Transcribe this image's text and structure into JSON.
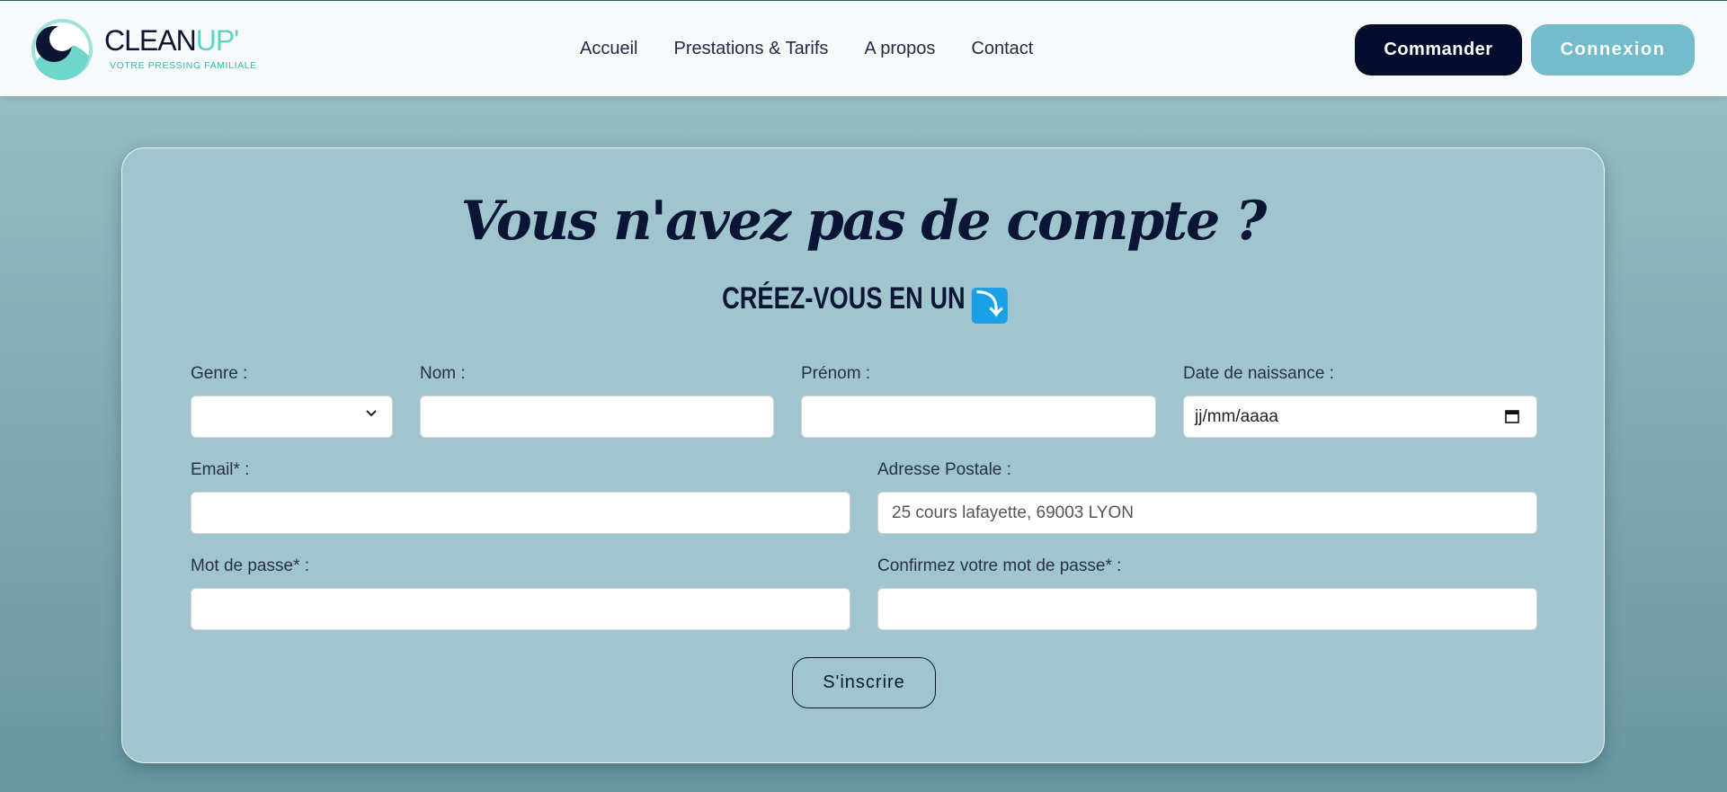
{
  "header": {
    "logo_text_main": "CLEAN",
    "logo_text_accent": "UP'",
    "logo_tagline": "VOTRE PRESSING FAMILIALE",
    "nav": [
      "Accueil",
      "Prestations & Tarifs",
      "A propos",
      "Contact"
    ],
    "commander_label": "Commander",
    "connexion_label": "Connexion"
  },
  "form": {
    "title": "Vous n'avez pas de compte ?",
    "subtitle": "CRÉEZ-VOUS EN UN",
    "subtitle_icon": "arrow-down-right-icon",
    "labels": {
      "genre": "Genre :",
      "nom": "Nom :",
      "prenom": "Prénom :",
      "date_naissance": "Date de naissance :",
      "email": "Email* :",
      "adresse": "Adresse Postale :",
      "password": "Mot de passe* :",
      "password_confirm": "Confirmez votre mot de passe* :"
    },
    "values": {
      "genre": "",
      "nom": "",
      "prenom": "",
      "date_naissance": "jj/mm/aaaa",
      "email": "",
      "password": "",
      "password_confirm": ""
    },
    "placeholders": {
      "adresse": "25 cours lafayette, 69003 LYON"
    },
    "submit_label": "S'inscrire"
  },
  "colors": {
    "primary_dark": "#050d2e",
    "accent_light": "#74bccc",
    "card_bg": "#a1c5ce",
    "logo_teal": "#5fd2c6"
  }
}
